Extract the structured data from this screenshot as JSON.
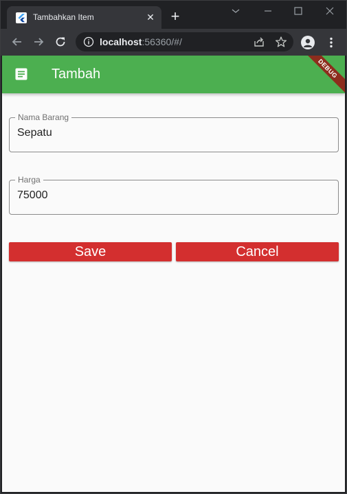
{
  "browser": {
    "tab_title": "Tambahkan Item",
    "url_host": "localhost",
    "url_rest": ":56360/#/"
  },
  "app": {
    "title": "Tambah",
    "debug_banner": "DEBUG",
    "accent_color": "#4caf50",
    "button_color": "#d32f2f"
  },
  "form": {
    "nama_barang": {
      "label": "Nama Barang",
      "value": "Sepatu"
    },
    "harga": {
      "label": "Harga",
      "value": "75000"
    }
  },
  "actions": {
    "save_label": "Save",
    "cancel_label": "Cancel"
  }
}
